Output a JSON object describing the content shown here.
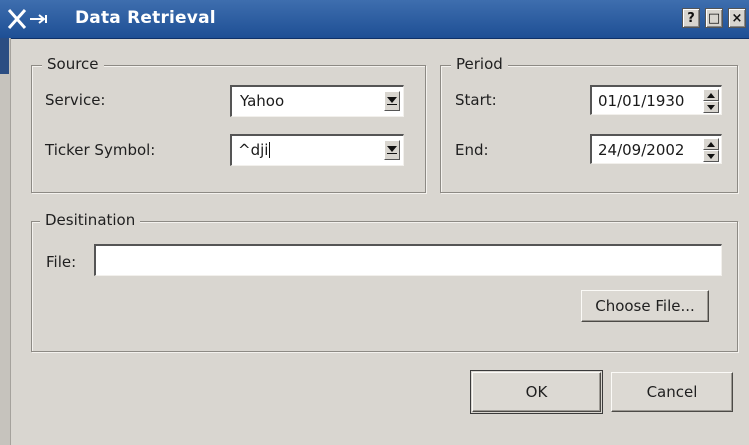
{
  "window": {
    "title": "Data Retrieval",
    "controls": [
      "?",
      "□",
      "×"
    ]
  },
  "source": {
    "legend": "Source",
    "service_label": "Service:",
    "service_value": "Yahoo",
    "ticker_label": "Ticker Symbol:",
    "ticker_value": "^dji"
  },
  "period": {
    "legend": "Period",
    "start_label": "Start:",
    "start_value": "01/01/1930",
    "end_label": "End:",
    "end_value": "24/09/2002"
  },
  "destination": {
    "legend": "Desitination",
    "file_label": "File:",
    "file_value": "",
    "choose_label": "Choose File..."
  },
  "buttons": {
    "ok_label": "OK",
    "cancel_label": "Cancel"
  }
}
